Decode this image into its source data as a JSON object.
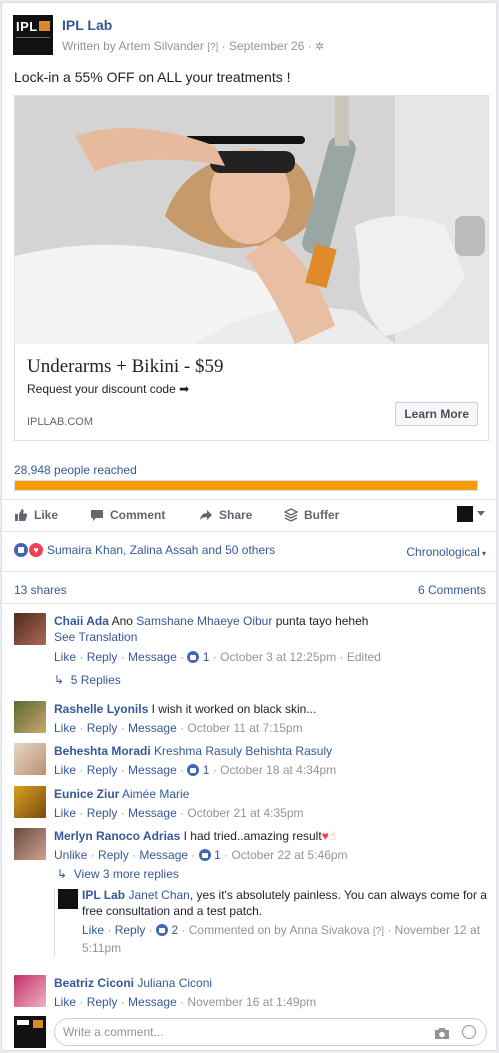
{
  "post": {
    "page_name": "IPL Lab",
    "logo_text": "IPL",
    "written_by": "Written by Artem Silvander",
    "help_marker": "[?]",
    "date": "September 26",
    "text": "Lock-in a 55% OFF on ALL your treatments !"
  },
  "link_card": {
    "title": "Underarms + Bikini - $59",
    "description": "Request your discount code ➡",
    "domain": "IPLLAB.COM",
    "cta": "Learn More"
  },
  "reach": {
    "text": "28,948 people reached",
    "fraction": 1.0,
    "color": "#f79a07"
  },
  "actions": {
    "like": "Like",
    "comment": "Comment",
    "share": "Share",
    "buffer": "Buffer"
  },
  "reactions": {
    "summary": "Sumaira Khan, Zalina Assah and 50 others",
    "sort": "Chronological"
  },
  "counts": {
    "shares": "13 shares",
    "comments": "6 Comments"
  },
  "comments": [
    {
      "author": "Chaii Ada",
      "text": "Ano",
      "tag": "Samshane Mhaeye Oibur",
      "text_after": "punta tayo heheh",
      "see_translation": "See Translation",
      "like": "Like",
      "reply": "Reply",
      "message": "Message",
      "likes": "1",
      "time": "October 3 at 12:25pm",
      "edited": "Edited",
      "replies": "5 Replies"
    },
    {
      "author": "Rashelle Lyonils",
      "text": "I wish it worked on black skin...",
      "like": "Like",
      "reply": "Reply",
      "message": "Message",
      "time": "October 11 at 7:15pm"
    },
    {
      "author": "Beheshta Moradi",
      "tag": "Kreshma Rasuly Behishta Rasuly",
      "like": "Like",
      "reply": "Reply",
      "message": "Message",
      "likes": "1",
      "time": "October 18 at 4:34pm"
    },
    {
      "author": "Eunice Ziur",
      "tag": "Aimée Marie",
      "like": "Like",
      "reply": "Reply",
      "message": "Message",
      "time": "October 21 at 4:35pm"
    },
    {
      "author": "Merlyn Ranoco Adrias",
      "text": "I had tried..amazing result",
      "like": "Unlike",
      "reply": "Reply",
      "message": "Message",
      "likes": "1",
      "time": "October 22 at 5:46pm",
      "more_replies": "View 3 more replies"
    },
    {
      "author": "Beatriz Ciconi",
      "tag": "Juliana Ciconi",
      "like": "Like",
      "reply": "Reply",
      "message": "Message",
      "time": "November 16 at 1:49pm"
    }
  ],
  "reply": {
    "author": "IPL Lab",
    "tag": "Janet Chan",
    "text": ", yes it's absolutely painless. You can always come for a free consultation and a test patch.",
    "like": "Like",
    "reply": "Reply",
    "likes": "2",
    "commented_on_by": "Commented on by Anna Sivakova",
    "help_marker": "[?]",
    "time": "November 12 at 5:11pm"
  },
  "composer": {
    "placeholder": "Write a comment..."
  },
  "colors": {
    "link": "#365899",
    "reach_bar": "#f79a07",
    "like_blue": "#4267b2",
    "love_red": "#f33e58"
  }
}
